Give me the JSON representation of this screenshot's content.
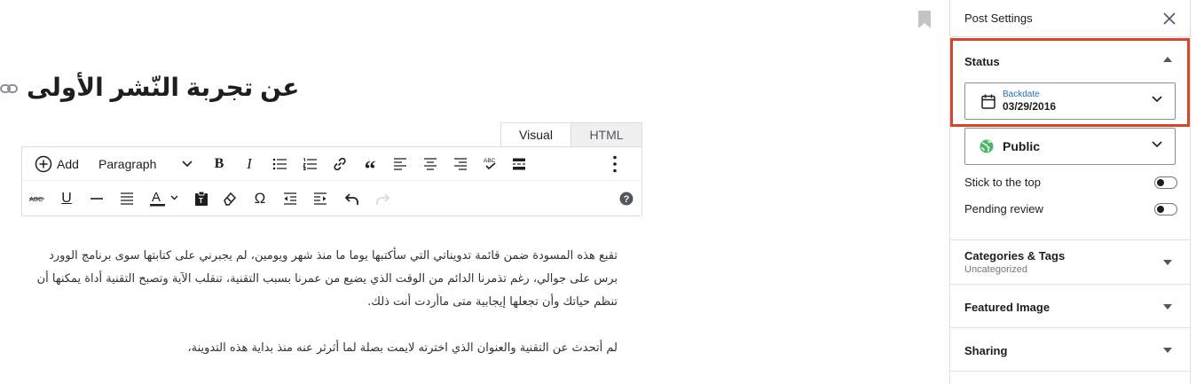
{
  "editor": {
    "title": "عن تجربة النّشر الأولى",
    "tabs": [
      "Visual",
      "HTML"
    ],
    "toolbar": {
      "add_label": "Add",
      "format_select": "Paragraph"
    },
    "paragraphs": [
      "تقبع هذه المسودة ضمن قائمة تدويناتي التي سأكتبها يوما ما منذ شهر ويومين، لم يجبرني على كتابتها سوى برنامج الوورد برس على جوالي، رغم تذمرنا الدائم من الوقت الذي يضيع من عمرنا بسبب التقنية، تنقلب الآية وتصبح التقنية أداة يمكنها أن تنظم حياتك وأن تجعلها إيجابية متى ماأردت أنت ذلك.",
      "لم أتحدث عن التقنية والعنوان الذي اخترته لايمت بصلة لما أثرثر عنه منذ بداية هذه التدوينة،"
    ]
  },
  "sidebar": {
    "header_title": "Post Settings",
    "status": {
      "title": "Status",
      "date_label": "Backdate",
      "date_value": "03/29/2016",
      "visibility": "Public",
      "stick_label": "Stick to the top",
      "pending_label": "Pending review"
    },
    "panels": {
      "categories_title": "Categories & Tags",
      "categories_sub": "Uncategorized",
      "featured_title": "Featured Image",
      "sharing_title": "Sharing"
    }
  },
  "colors": {
    "highlight": "#d9452b",
    "link": "#2271b1",
    "globe": "#4ab866"
  }
}
